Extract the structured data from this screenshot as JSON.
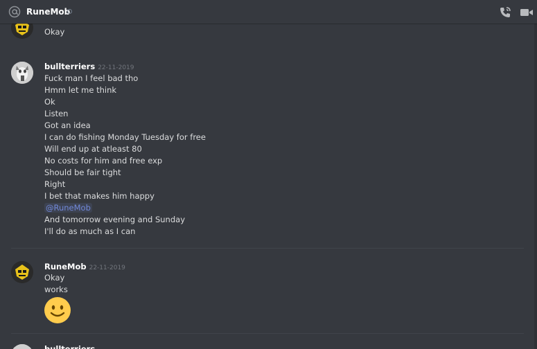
{
  "header": {
    "channel_name": "RuneMob",
    "at_icon": "at-sign-icon",
    "call_icon": "phone-call-icon",
    "video_icon": "video-camera-icon"
  },
  "messages": [
    {
      "author": "",
      "timestamp": "",
      "avatar_icon": "yellow-mask-avatar",
      "lines": [
        "Okay"
      ]
    },
    {
      "author": "bullterriers",
      "timestamp": "22-11-2019",
      "avatar_icon": "dog-photo-avatar",
      "lines": [
        "Fuck man I feel bad tho",
        "Hmm let me think",
        "Ok",
        "Listen",
        "Got an idea",
        "I can do fishing Monday Tuesday for free",
        "Will end up at atleast 80",
        "No costs for him and free exp",
        "Should be fair tight",
        "Right",
        "I bet that makes him happy",
        "@RuneMob",
        "And tomorrow evening and Sunday",
        "I'll do as much as I can"
      ]
    },
    {
      "author": "RuneMob",
      "timestamp": "22-11-2019",
      "avatar_icon": "yellow-mask-avatar",
      "lines": [
        "Okay",
        "works"
      ],
      "emoji": "slightly-smiling-face"
    },
    {
      "author": "bullterriers",
      "timestamp": "",
      "avatar_icon": "dog-photo-avatar",
      "lines": []
    }
  ],
  "colors": {
    "background": "#36393f",
    "text": "#dcddde",
    "username": "#ffffff",
    "timestamp": "#72767d",
    "mention": "#7289da"
  }
}
